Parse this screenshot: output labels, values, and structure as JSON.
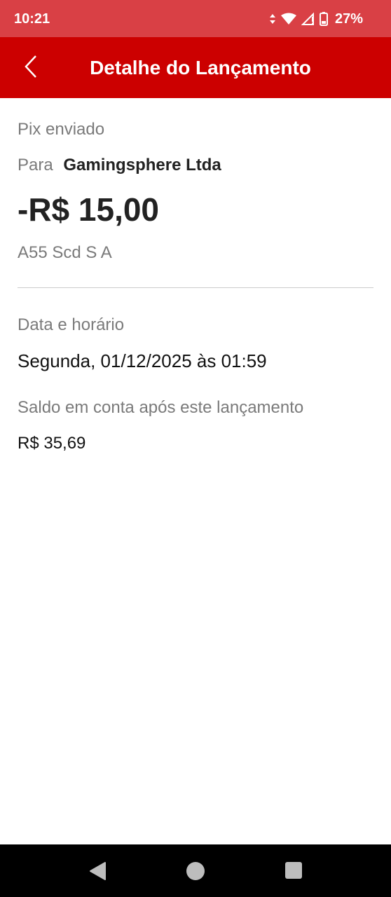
{
  "status_bar": {
    "time": "10:21",
    "battery_percent": "27%",
    "icons": [
      "data-arrows-icon",
      "wifi-icon",
      "signal-icon",
      "battery-icon"
    ],
    "background_color": "#d94045"
  },
  "header": {
    "title": "Detalhe do Lançamento",
    "back_icon": "chevron-left-icon",
    "background_color": "#cc0000"
  },
  "transaction": {
    "type": "Pix enviado",
    "recipient_label": "Para",
    "recipient_name": "Gamingsphere Ltda",
    "amount": "-R$ 15,00",
    "bank": "A55 Scd S A"
  },
  "details": {
    "datetime_label": "Data e horário",
    "datetime_value": "Segunda, 01/12/2025 às 01:59",
    "balance_label": "Saldo em conta após este lançamento",
    "balance_value": "R$ 35,69"
  },
  "nav_bar": {
    "buttons": [
      "back-triangle-icon",
      "home-circle-icon",
      "recents-square-icon"
    ]
  }
}
